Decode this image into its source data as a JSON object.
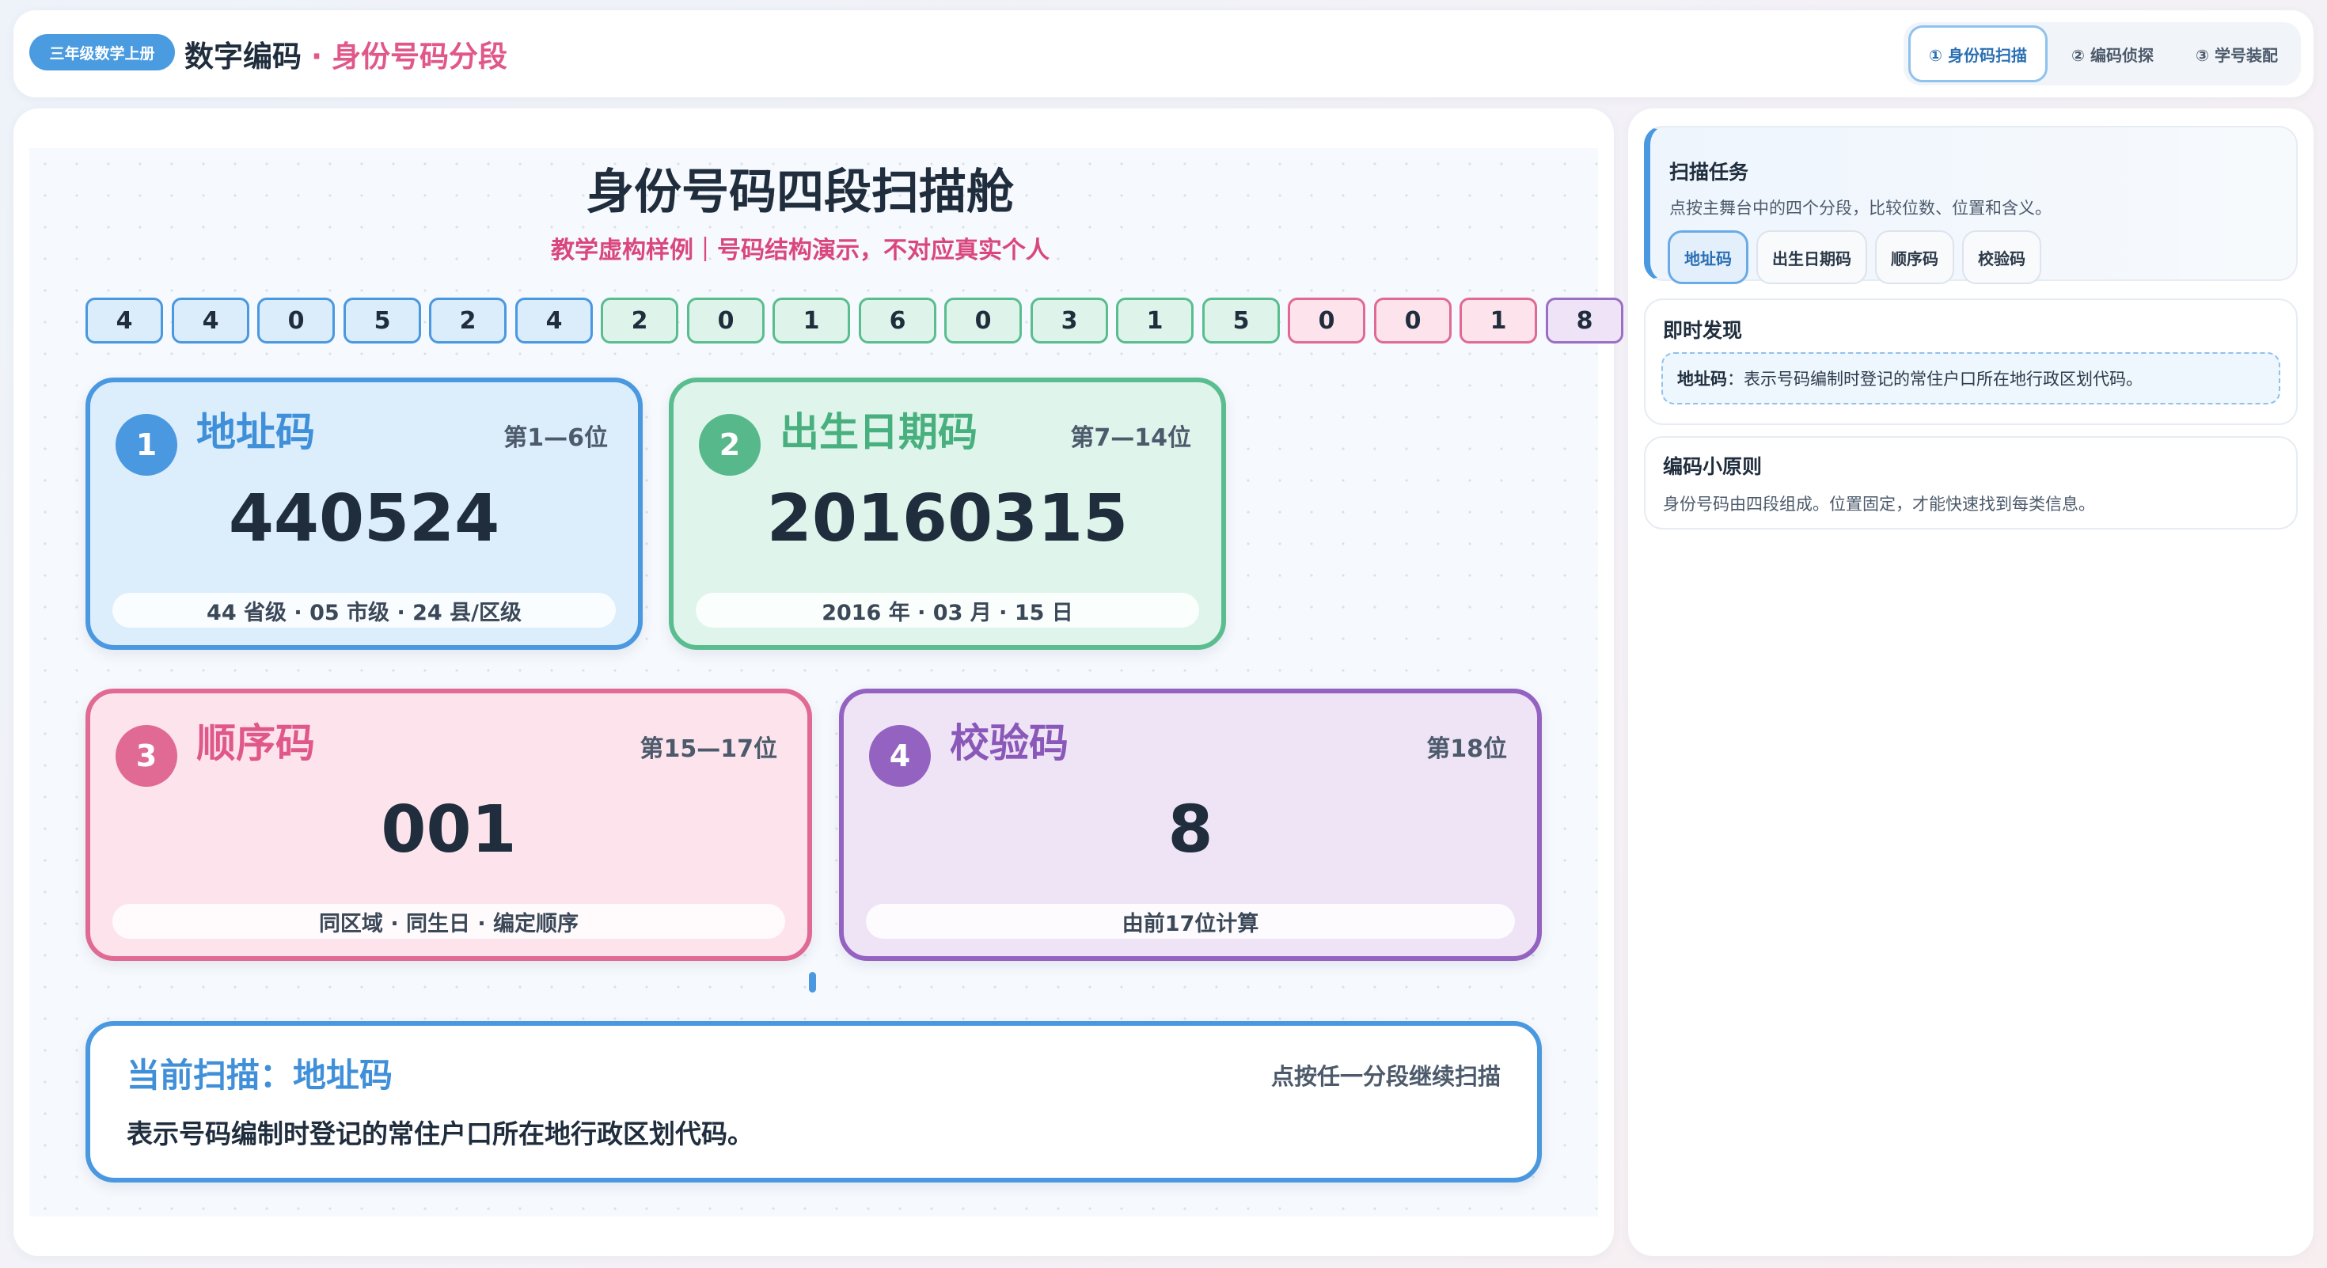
{
  "header": {
    "grade_badge": "三年级数学上册",
    "title": "数字编码",
    "separator": "·",
    "subtitle": "身份号码分段",
    "tabs": [
      {
        "label": "① 身份码扫描",
        "active": true
      },
      {
        "label": "② 编码侦探",
        "active": false
      },
      {
        "label": "③ 学号装配",
        "active": false
      }
    ]
  },
  "stage": {
    "title": "身份号码四段扫描舱",
    "subtitle": "教学虚构样例｜号码结构演示，不对应真实个人",
    "digits": [
      {
        "d": "4",
        "seg": "addr"
      },
      {
        "d": "4",
        "seg": "addr"
      },
      {
        "d": "0",
        "seg": "addr"
      },
      {
        "d": "5",
        "seg": "addr"
      },
      {
        "d": "2",
        "seg": "addr"
      },
      {
        "d": "4",
        "seg": "addr"
      },
      {
        "d": "2",
        "seg": "birth"
      },
      {
        "d": "0",
        "seg": "birth"
      },
      {
        "d": "1",
        "seg": "birth"
      },
      {
        "d": "6",
        "seg": "birth"
      },
      {
        "d": "0",
        "seg": "birth"
      },
      {
        "d": "3",
        "seg": "birth"
      },
      {
        "d": "1",
        "seg": "birth"
      },
      {
        "d": "5",
        "seg": "birth"
      },
      {
        "d": "0",
        "seg": "seq"
      },
      {
        "d": "0",
        "seg": "seq"
      },
      {
        "d": "1",
        "seg": "seq"
      },
      {
        "d": "8",
        "seg": "check"
      }
    ],
    "segments": {
      "addr": {
        "num": "1",
        "name": "地址码",
        "pos": "第1—6位",
        "value": "440524",
        "note": "44 省级 · 05 市级 · 24 县/区级"
      },
      "birth": {
        "num": "2",
        "name": "出生日期码",
        "pos": "第7—14位",
        "value": "20160315",
        "note": "2016 年 · 03 月 · 15 日"
      },
      "seq": {
        "num": "3",
        "name": "顺序码",
        "pos": "第15—17位",
        "value": "001",
        "note": "同区域 · 同生日 · 编定顺序"
      },
      "check": {
        "num": "4",
        "name": "校验码",
        "pos": "第18位",
        "value": "8",
        "note": "由前17位计算"
      }
    },
    "current": {
      "title": "当前扫描：地址码",
      "hint": "点按任一分段继续扫描",
      "desc": "表示号码编制时登记的常住户口所在地行政区划代码。"
    }
  },
  "side": {
    "task": {
      "title": "扫描任务",
      "text": "点按主舞台中的四个分段，比较位数、位置和含义。",
      "chips": [
        {
          "label": "地址码",
          "active": true
        },
        {
          "label": "出生日期码",
          "active": false
        },
        {
          "label": "顺序码",
          "active": false
        },
        {
          "label": "校验码",
          "active": false
        }
      ]
    },
    "find": {
      "title": "即时发现",
      "term": "地址码",
      "text": "：表示号码编制时登记的常住户口所在地行政区划代码。"
    },
    "rule": {
      "title": "编码小原则",
      "text": "身份号码由四段组成。位置固定，才能快速找到每类信息。"
    }
  },
  "colors": {
    "addr": "#4a98e0",
    "birth": "#5abd90",
    "seq": "#e06a93",
    "check": "#9462c0",
    "accent_pink": "#e0588a"
  }
}
